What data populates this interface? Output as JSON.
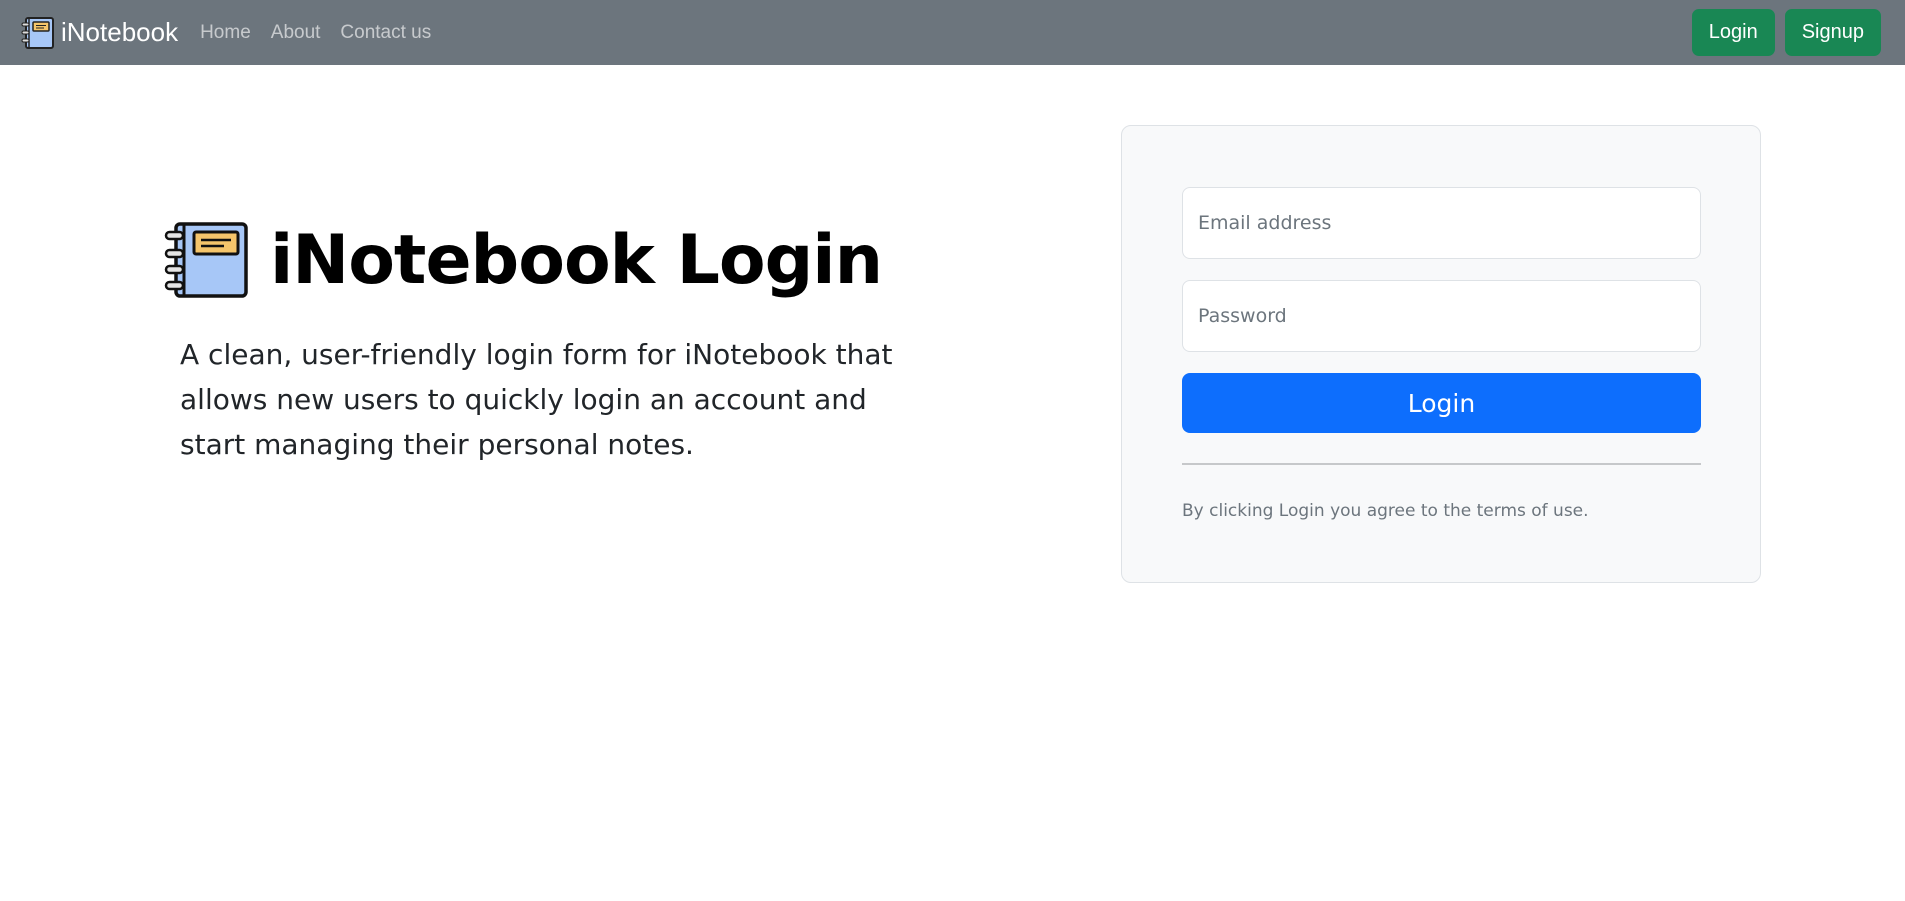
{
  "navbar": {
    "brand": "iNotebook",
    "brand_icon": "notebook-icon",
    "links": [
      "Home",
      "About",
      "Contact us"
    ],
    "login_label": "Login",
    "signup_label": "Signup",
    "background": "#6c757d",
    "button_color": "#198754"
  },
  "hero": {
    "icon": "notebook-icon",
    "title": "iNotebook Login",
    "description": "A clean, user-friendly login form for iNotebook that allows new users to quickly login an account and start managing their personal notes."
  },
  "login_form": {
    "email_placeholder": "Email address",
    "password_placeholder": "Password",
    "submit_label": "Login",
    "terms_text": "By clicking Login you agree to the terms of use.",
    "primary_color": "#0d6efd"
  }
}
